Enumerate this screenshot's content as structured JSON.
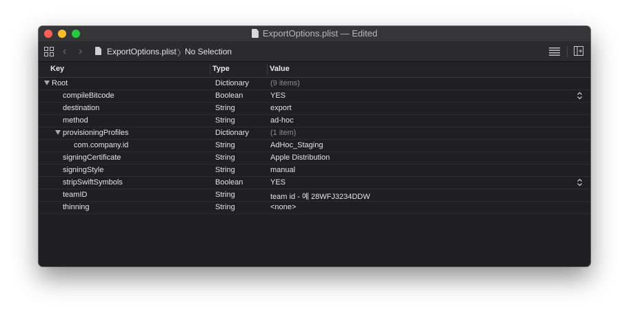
{
  "window": {
    "title": "ExportOptions.plist — Edited"
  },
  "toolbar": {
    "breadcrumb_file": "ExportOptions.plist",
    "breadcrumb_separator": "〉",
    "breadcrumb_selection": "No Selection"
  },
  "columns": {
    "key": "Key",
    "type": "Type",
    "value": "Value"
  },
  "rows": [
    {
      "key": "Root",
      "type": "Dictionary",
      "value": "(9 items)",
      "level": 0,
      "disclosure": true,
      "dim": true
    },
    {
      "key": "compileBitcode",
      "type": "Boolean",
      "value": "YES",
      "level": 1,
      "stepper": true
    },
    {
      "key": "destination",
      "type": "String",
      "value": "export",
      "level": 1
    },
    {
      "key": "method",
      "type": "String",
      "value": "ad-hoc",
      "level": 1
    },
    {
      "key": "provisioningProfiles",
      "type": "Dictionary",
      "value": "(1 item)",
      "level": 1,
      "disclosure": true,
      "dim": true
    },
    {
      "key": "com.company.id",
      "type": "String",
      "value": "AdHoc_Staging",
      "level": 2
    },
    {
      "key": "signingCertificate",
      "type": "String",
      "value": "Apple Distribution",
      "level": 1
    },
    {
      "key": "signingStyle",
      "type": "String",
      "value": "manual",
      "level": 1
    },
    {
      "key": "stripSwiftSymbols",
      "type": "Boolean",
      "value": "YES",
      "level": 1,
      "stepper": true
    },
    {
      "key": "teamID",
      "type": "String",
      "value": "team id - 예 28WFJ3234DDW",
      "level": 1
    },
    {
      "key": "thinning",
      "type": "String",
      "value": "<none>",
      "level": 1
    }
  ],
  "colors": {
    "window_bg": "#1f1f21",
    "titlebar": "#363638",
    "close": "#ff5f57",
    "minimize": "#febc2e",
    "zoom": "#28c840"
  }
}
